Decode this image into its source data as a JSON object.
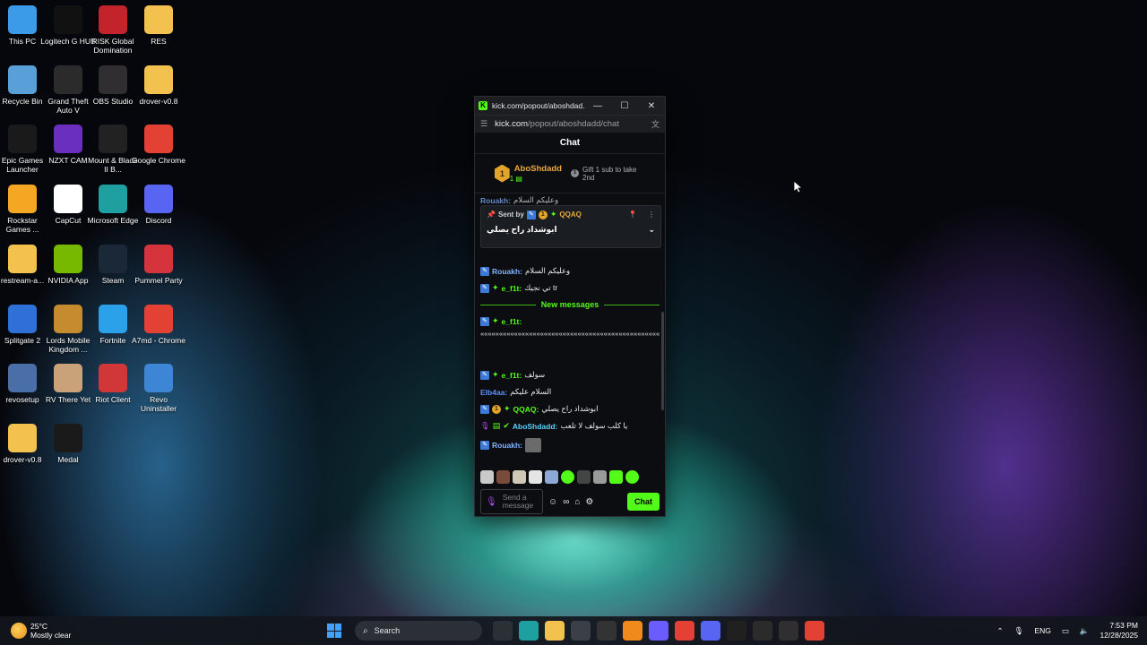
{
  "desktop": {
    "icons": [
      {
        "label": "This PC",
        "icon": "this-pc-icon",
        "color": "#3b9be8"
      },
      {
        "label": "Logitech G HUB",
        "icon": "logitech-icon",
        "color": "#111111"
      },
      {
        "label": "RISK Global Domination",
        "icon": "risk-icon",
        "color": "#c3232b"
      },
      {
        "label": "RES",
        "icon": "folder-icon",
        "color": "#f2c14e"
      },
      {
        "label": "Recycle Bin",
        "icon": "recycle-bin-icon",
        "color": "#5aa0d8"
      },
      {
        "label": "Grand Theft Auto V",
        "icon": "gta-icon",
        "color": "#2b2b2b"
      },
      {
        "label": "OBS Studio",
        "icon": "obs-icon",
        "color": "#302e31"
      },
      {
        "label": "drover-v0.8",
        "icon": "folder-icon",
        "color": "#f2c14e"
      },
      {
        "label": "Epic Games Launcher",
        "icon": "epic-icon",
        "color": "#1a1a1a"
      },
      {
        "label": "NZXT CAM",
        "icon": "nzxt-icon",
        "color": "#6a2fbf"
      },
      {
        "label": "Mount & Blade II B...",
        "icon": "bannerlord-icon",
        "color": "#222222"
      },
      {
        "label": "Google Chrome",
        "icon": "chrome-icon",
        "color": "#e34133"
      },
      {
        "label": "Rockstar Games ...",
        "icon": "rockstar-icon",
        "color": "#f5a623"
      },
      {
        "label": "CapCut",
        "icon": "capcut-icon",
        "color": "#ffffff"
      },
      {
        "label": "Microsoft Edge",
        "icon": "edge-icon",
        "color": "#1fa0a0"
      },
      {
        "label": "Discord",
        "icon": "discord-icon",
        "color": "#5865f2"
      },
      {
        "label": "restream-a...",
        "icon": "folder-icon",
        "color": "#f2c14e"
      },
      {
        "label": "NVIDIA App",
        "icon": "nvidia-icon",
        "color": "#76b900"
      },
      {
        "label": "Steam",
        "icon": "steam-icon",
        "color": "#1b2838"
      },
      {
        "label": "Pummel Party",
        "icon": "pummel-party-icon",
        "color": "#d6343c"
      },
      {
        "label": "Splitgate 2",
        "icon": "splitgate-icon",
        "color": "#2f6fd8"
      },
      {
        "label": "Lords Mobile Kingdom ...",
        "icon": "lords-mobile-icon",
        "color": "#c68b2e"
      },
      {
        "label": "Fortnite",
        "icon": "fortnite-icon",
        "color": "#2aa1e8"
      },
      {
        "label": "A7md - Chrome",
        "icon": "chrome-profile-icon",
        "color": "#e34133"
      },
      {
        "label": "revosetup",
        "icon": "revo-setup-icon",
        "color": "#4a6fa8"
      },
      {
        "label": "RV There Yet",
        "icon": "rv-there-yet-icon",
        "color": "#c9a27a"
      },
      {
        "label": "Riot Client",
        "icon": "riot-icon",
        "color": "#d13639"
      },
      {
        "label": "Revo Uninstaller",
        "icon": "revo-uninstaller-icon",
        "color": "#3d86d6"
      },
      {
        "label": "drover-v0.8",
        "icon": "folder-icon",
        "color": "#f2c14e"
      },
      {
        "label": "Medal",
        "icon": "medal-icon",
        "color": "#1a1a1a"
      }
    ]
  },
  "popout": {
    "window_title": "kick.com/popout/aboshdad...",
    "minimize": "—",
    "maximize": "☐",
    "close": "✕",
    "url_host": "kick.com",
    "url_path": "/popout/aboshdadd/chat",
    "chat_title": "Chat",
    "leaderboard": {
      "rank": "1",
      "name": "AboShdadd",
      "count": "1",
      "gift_text": "Gift 1 sub to take 2nd"
    },
    "partial_top": {
      "user": "Rouakh:",
      "text": "وعليكم السلام"
    },
    "pinned": {
      "sent_by": "Sent by",
      "user": "QQAQ",
      "text": "ابوشداد راح يصلي"
    },
    "messages_before": [
      {
        "user": "Rouakh:",
        "text": "وعليكم السلام",
        "color": "#7fb4ff"
      },
      {
        "user": "e_f1t:",
        "text": "تي نجيك tr",
        "color": "#53fc18"
      }
    ],
    "new_messages_label": "New messages",
    "long_message_user": "e_f1t:",
    "long_message_text": "««««««««««««««««««««««««««««««««««««««««««««««««««««««««««««««««««««««««««««««««««««««««««««««",
    "messages_after": [
      {
        "user": "e_f1t:",
        "text": "سولف",
        "color": "#53fc18"
      },
      {
        "user": "Elb4aa:",
        "text": "السلام عليكم",
        "color": "#5b8cff"
      },
      {
        "user": "QQAQ:",
        "text": "ابوشداد راح يصلي",
        "color": "#53fc18"
      },
      {
        "user": "AboShdadd:",
        "text": "يا كلب سولف لا تلعب",
        "color": "#5bd3ff"
      },
      {
        "user": "Rouakh:",
        "text": "",
        "color": "#7fb4ff"
      }
    ],
    "input_placeholder": "Send a message",
    "send_label": "Chat"
  },
  "taskbar": {
    "temperature": "25°C",
    "weather": "Mostly clear",
    "search_label": "Search",
    "apps": [
      {
        "icon": "task-view-icon",
        "color": "#2b2f36"
      },
      {
        "icon": "edge-icon",
        "color": "#1fa0a0"
      },
      {
        "icon": "file-explorer-icon",
        "color": "#f2c14e"
      },
      {
        "icon": "store-icon",
        "color": "#3a3f48"
      },
      {
        "icon": "capcut-icon",
        "color": "#333333"
      },
      {
        "icon": "vlc-icon",
        "color": "#f08a1c"
      },
      {
        "icon": "copilot-icon",
        "color": "#6b5cff"
      },
      {
        "icon": "chrome-icon",
        "color": "#e34133"
      },
      {
        "icon": "discord-icon",
        "color": "#5865f2"
      },
      {
        "icon": "kick-icon",
        "color": "#202020"
      },
      {
        "icon": "terminal-icon",
        "color": "#2b2b2b"
      },
      {
        "icon": "obs-icon",
        "color": "#302e31"
      },
      {
        "icon": "chrome-active-icon",
        "color": "#e34133"
      }
    ],
    "language": "ENG",
    "time": "7:53 PM",
    "date": "12/28/2025"
  }
}
